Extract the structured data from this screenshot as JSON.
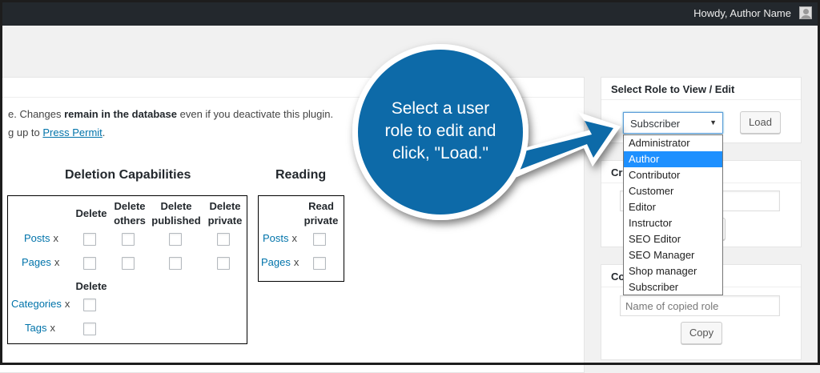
{
  "admin_bar": {
    "greeting": "Howdy, Author Name",
    "avatar_icon": "user-avatar-icon"
  },
  "notice": {
    "line1_prefix": "e. Changes ",
    "line1_bold": "remain in the database",
    "line1_suffix": " even if you deactivate this plugin.",
    "line2_prefix": "g up to ",
    "line2_link": "Press Permit",
    "line2_suffix": "."
  },
  "deletion": {
    "heading": "Deletion Capabilities",
    "columns": [
      "Delete",
      "Delete others",
      "Delete published",
      "Delete private"
    ],
    "rows": [
      {
        "label": "Posts",
        "remove": "x"
      },
      {
        "label": "Pages",
        "remove": "x"
      }
    ],
    "tax_column": "Delete",
    "tax_rows": [
      {
        "label": "Categories",
        "remove": "x"
      },
      {
        "label": "Tags",
        "remove": "x"
      }
    ]
  },
  "reading": {
    "heading": "Reading",
    "column": "Read private",
    "rows": [
      {
        "label": "Posts",
        "remove": "x"
      },
      {
        "label": "Pages",
        "remove": "x"
      }
    ]
  },
  "select_role": {
    "title": "Select Role to View / Edit",
    "selected": "Subscriber",
    "load_label": "Load",
    "options": [
      "Administrator",
      "Author",
      "Contributor",
      "Customer",
      "Editor",
      "Instructor",
      "SEO Editor",
      "SEO Manager",
      "Shop manager",
      "Subscriber"
    ],
    "highlighted": "Author"
  },
  "create_box": {
    "title_partial": "Cre"
  },
  "copy_box": {
    "title_partial": "Co",
    "placeholder": "Name of copied role",
    "copy_label": "Copy"
  },
  "callout": {
    "text": "Select a user\nrole to edit and\nclick, \"Load.\"",
    "fill": "#0e6ba8",
    "ring": "#ffffff"
  }
}
